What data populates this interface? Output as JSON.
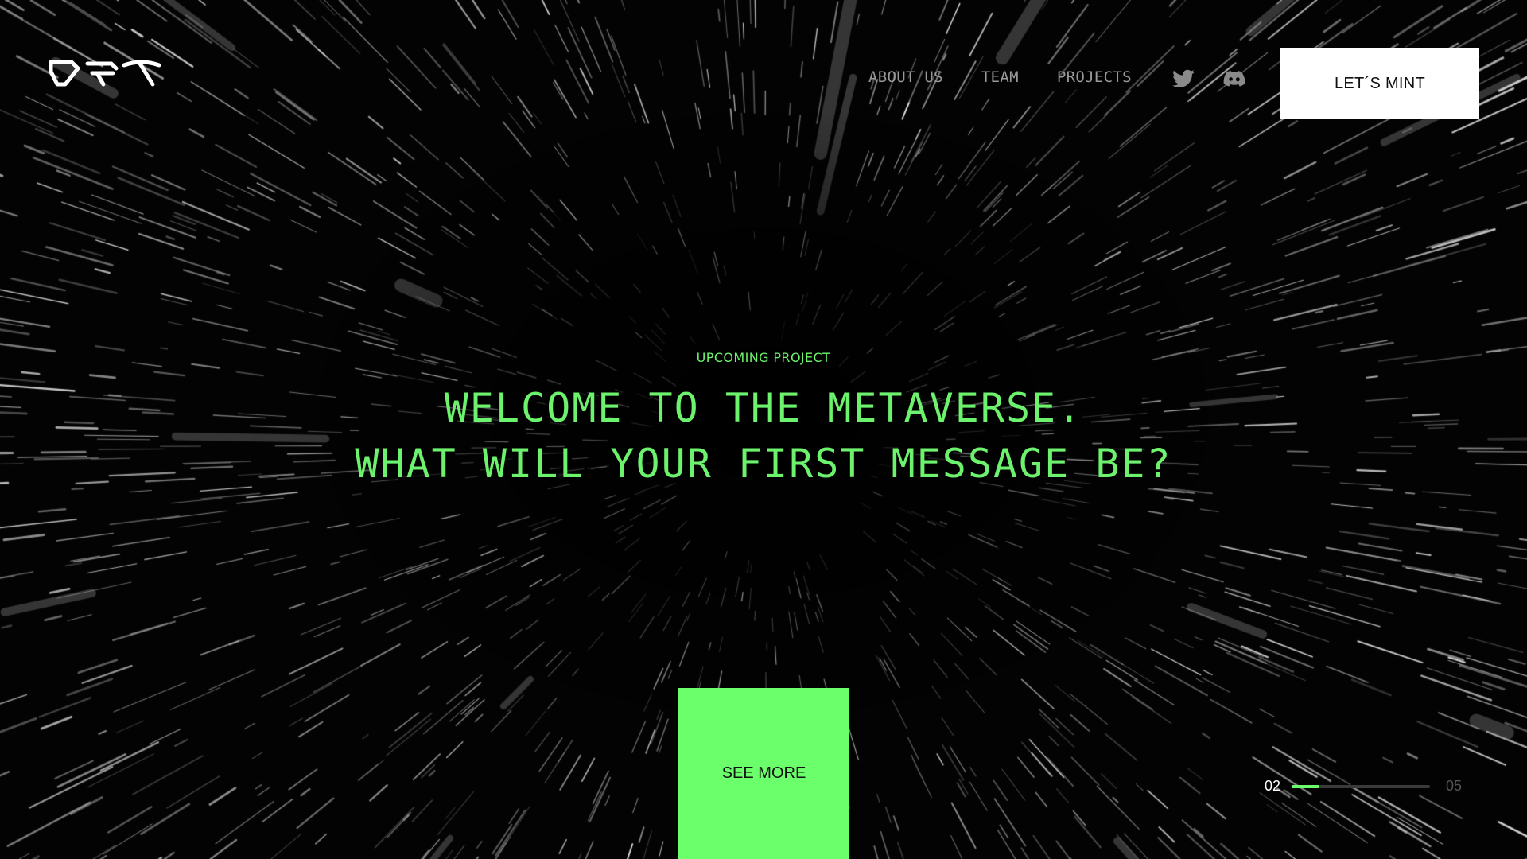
{
  "colors": {
    "accent": "#6bff6b",
    "background": "#030303",
    "nav_text": "#9a9a9a",
    "mint_button": "#ffffff"
  },
  "header": {
    "logo_text": "OFT",
    "nav": [
      {
        "label": "ABOUT US"
      },
      {
        "label": "TEAM"
      },
      {
        "label": "PROJECTS"
      }
    ],
    "social": [
      {
        "icon": "twitter-icon"
      },
      {
        "icon": "discord-icon"
      }
    ],
    "mint_label": "LET´S MINT"
  },
  "hero": {
    "kicker": "UPCOMING PROJECT",
    "headline_line1": "WELCOME TO THE METAVERSE.",
    "headline_line2": "WHAT WILL YOUR FIRST MESSAGE BE?",
    "cta_label": "SEE MORE"
  },
  "pager": {
    "current": "02",
    "total": "05",
    "progress": 0.2
  }
}
